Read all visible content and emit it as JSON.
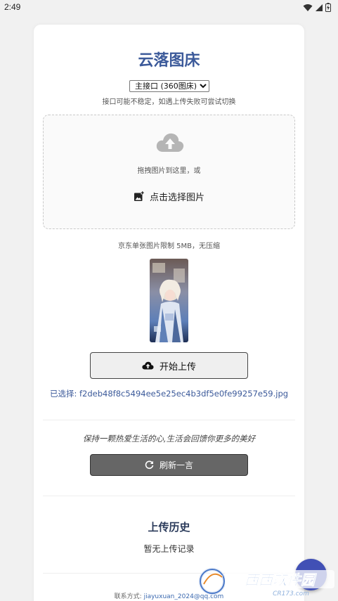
{
  "status_bar": {
    "time": "2:49",
    "icons": [
      "wifi-icon",
      "signal-icon",
      "battery-icon"
    ]
  },
  "app": {
    "title": "云落图床",
    "accent_color": "#3c5a9a"
  },
  "api": {
    "selected": "主接口 (360图床)",
    "note": "接口可能不稳定，如遇上传失败可尝试切换"
  },
  "dropzone": {
    "drag_text": "拖拽图片到这里，或",
    "pick_label": "点击选择图片",
    "limit_note": "京东单张图片限制 5MB，无压缩"
  },
  "upload": {
    "button_label": "开始上传",
    "selected_label": "已选择: f2deb48f8c5494ee5e25ec4b3df5e0fe99257e59.jpg"
  },
  "quote": {
    "text": "保持一颗热爱生活的心,生活会回馈你更多的美好",
    "refresh_label": "刷新一言"
  },
  "history": {
    "title": "上传历史",
    "empty_text": "暂无上传记录"
  },
  "footer": {
    "contact_label": "联系方式:",
    "contact_email": "jiayuxuan_2024@qq.com"
  },
  "watermark": {
    "brand_text": "西西软件园",
    "domain_text": "CR173.com"
  }
}
